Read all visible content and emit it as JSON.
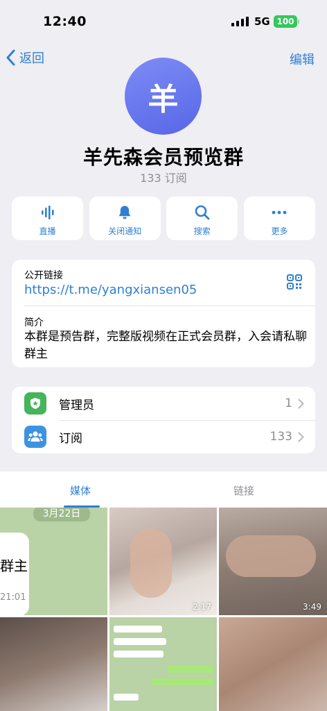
{
  "status": {
    "time": "12:40",
    "network": "5G",
    "battery": "100"
  },
  "nav": {
    "back_label": "返回",
    "edit_label": "编辑"
  },
  "group": {
    "avatar_letter": "羊",
    "title": "羊先森会员预览群",
    "subscribers": "133 订阅"
  },
  "actions": [
    {
      "icon": "live-waveform-icon",
      "label": "直播"
    },
    {
      "icon": "bell-icon",
      "label": "关闭通知"
    },
    {
      "icon": "search-icon",
      "label": "搜索"
    },
    {
      "icon": "more-icon",
      "label": "更多"
    }
  ],
  "info": {
    "link_label": "公开链接",
    "link": "https://t.me/yangxiansen05",
    "bio_label": "简介",
    "bio": "本群是预告群，完整版视频在正式会员群，入会请私聊群主"
  },
  "list": [
    {
      "icon": "admin-badge-icon",
      "label": "管理员",
      "value": "1",
      "color": "#45b45a"
    },
    {
      "icon": "subscribers-icon",
      "label": "订阅",
      "value": "133",
      "color": "#3e93e0"
    }
  ],
  "tabs": {
    "media": "媒体",
    "links": "链接"
  },
  "media": {
    "tile1_date": "3月22日",
    "tile1_text": "群主",
    "tile1_time": "21:01",
    "tile2_duration": "2:17",
    "tile3_duration": "3:49"
  },
  "colors": {
    "accent": "#2f7fd1",
    "background": "#eeeef3",
    "battery": "#34c759"
  }
}
